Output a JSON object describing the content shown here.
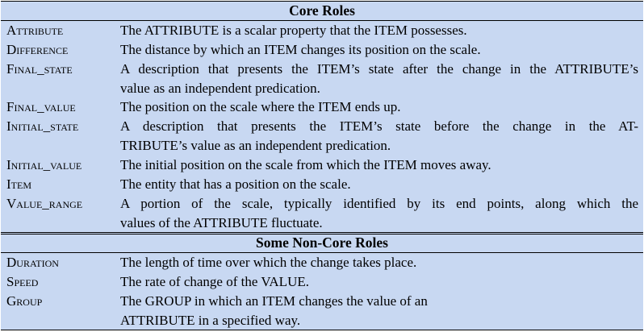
{
  "sections": [
    {
      "title": "Core Roles",
      "rows": [
        {
          "term": "Attribute",
          "lines": [
            "The ATTRIBUTE is a scalar property that the ITEM possesses."
          ]
        },
        {
          "term": "Difference",
          "lines": [
            "The distance by which an ITEM changes its position on the scale."
          ]
        },
        {
          "term": "Final_state",
          "lines": [
            "A description that presents the ITEM’s state after the change in the ATTRIBUTE’s",
            "value as an independent predication."
          ]
        },
        {
          "term": "Final_value",
          "lines": [
            "The position on the scale where the ITEM ends up."
          ]
        },
        {
          "term": "Initial_state",
          "lines": [
            "A description that presents the ITEM’s state before the change in the AT-",
            "TRIBUTE’s value as an independent predication."
          ]
        },
        {
          "term": "Initial_value",
          "lines": [
            "The initial position on the scale from which the ITEM moves away."
          ]
        },
        {
          "term": "Item",
          "lines": [
            "The entity that has a position on the scale."
          ]
        },
        {
          "term": "Value_range",
          "lines": [
            "A portion of the scale, typically identified by its end points, along which the",
            "values of the ATTRIBUTE fluctuate."
          ]
        }
      ]
    },
    {
      "title": "Some Non-Core Roles",
      "rows": [
        {
          "term": "Duration",
          "lines": [
            "The length of time over which the change takes place."
          ]
        },
        {
          "term": "Speed",
          "lines": [
            "The rate of change of the VALUE."
          ]
        },
        {
          "term": "Group",
          "lines": [
            "The GROUP in which an ITEM changes the value of an",
            "ATTRIBUTE in a specified way."
          ]
        }
      ]
    }
  ],
  "colors": {
    "background": "#c8d8f2",
    "rule": "#000000"
  }
}
